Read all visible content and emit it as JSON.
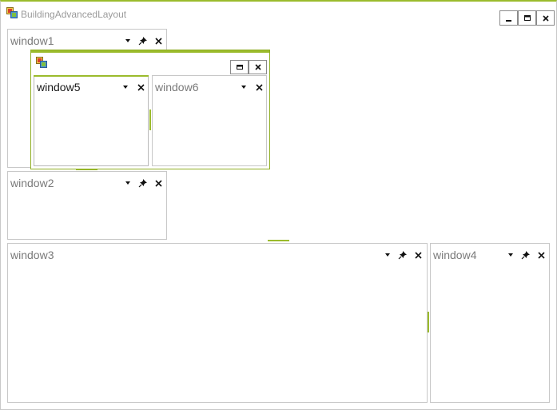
{
  "app": {
    "title": "BuildingAdvancedLayout",
    "icon": "app-icon",
    "accent": "#9bbb2c",
    "controls": [
      "minimize",
      "maximize",
      "close"
    ]
  },
  "panes": {
    "window1": {
      "title": "window1",
      "buttons": [
        "dropdown-icon",
        "pin-icon",
        "close-icon"
      ]
    },
    "window2": {
      "title": "window2",
      "buttons": [
        "dropdown-icon",
        "pin-icon",
        "close-icon"
      ]
    },
    "window3": {
      "title": "window3",
      "buttons": [
        "dropdown-icon",
        "pin-icon",
        "close-icon"
      ]
    },
    "window4": {
      "title": "window4",
      "buttons": [
        "dropdown-icon",
        "pin-icon",
        "close-icon"
      ]
    }
  },
  "floating": {
    "icon": "app-icon",
    "controls": [
      "maximize",
      "close"
    ],
    "panes": {
      "window5": {
        "title": "window5",
        "active": true,
        "buttons": [
          "dropdown-icon",
          "close-icon"
        ]
      },
      "window6": {
        "title": "window6",
        "active": false,
        "buttons": [
          "dropdown-icon",
          "close-icon"
        ]
      }
    }
  }
}
